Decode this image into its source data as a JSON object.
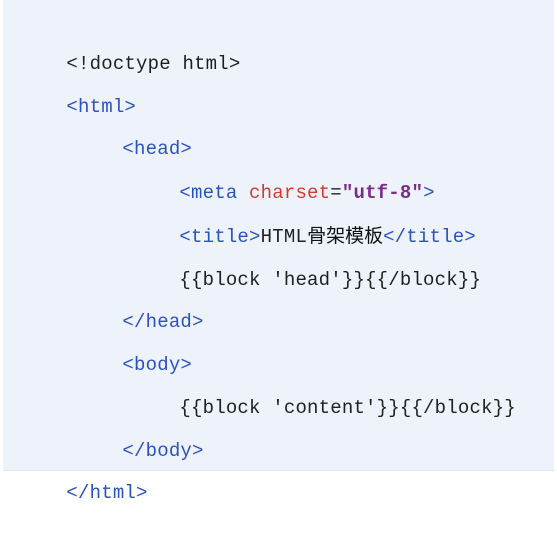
{
  "colors": {
    "background": "#eef3fb",
    "tag": "#2a52be",
    "attribute": "#d33a2c",
    "attribute_value": "#7a2b8b",
    "text": "#1f1f1f"
  },
  "code": {
    "lines": [
      {
        "doctype": "<!doctype html>"
      },
      {
        "open": "<html>"
      },
      {
        "open": "<head>"
      },
      {
        "tag_open": "<meta",
        "space": " ",
        "attr_name": "charset",
        "equals": "=",
        "attr_value": "\"utf-8\"",
        "tag_close": ">"
      },
      {
        "tag_open": "<title>",
        "text_latin": "HTML",
        "text_cn": "骨架模板",
        "tag_close": "</title>"
      },
      {
        "text": "{{block 'head'}}{{/block}}"
      },
      {
        "close": "</head>"
      },
      {
        "open": "<body>"
      },
      {
        "text": "{{block 'content'}}{{/block}}"
      },
      {
        "close": "</body>"
      },
      {
        "close": "</html>"
      }
    ]
  }
}
